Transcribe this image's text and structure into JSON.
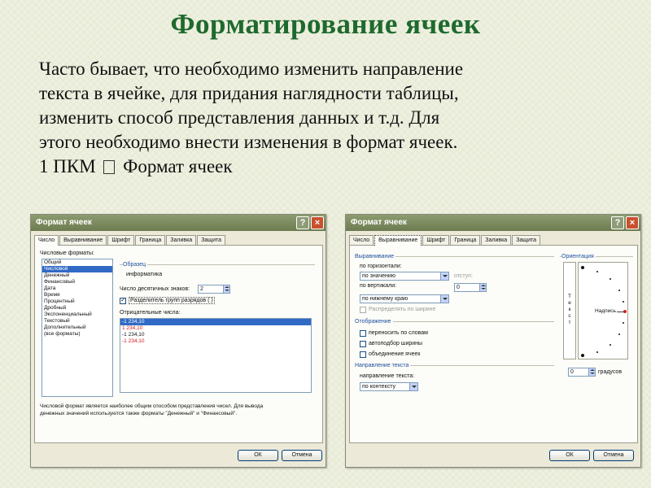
{
  "slide": {
    "title": "Форматирование ячеек",
    "paragraph_lines": [
      "Часто бывает, что необходимо изменить направление",
      "текста в ячейке, для придания наглядности таблицы,",
      "изменить способ представления данных и т.д. Для",
      "этого необходимо внести изменения в формат ячеек."
    ],
    "step_prefix": "1 ПКМ",
    "step_suffix": "Формат ячеек"
  },
  "colors": {
    "title_green": "#1e6a2e",
    "titlebar": "#7a8a5e",
    "close_red": "#c9502e",
    "selection_blue": "#316ac5",
    "negative_red": "#d41818"
  },
  "dialog_left": {
    "title": "Формат ячеек",
    "help_icon": "?",
    "close_icon": "×",
    "tabs": [
      "Число",
      "Выравнивание",
      "Шрифт",
      "Граница",
      "Заливка",
      "Защита"
    ],
    "active_tab": "Число",
    "formats_label": "Числовые форматы:",
    "formats": [
      "Общий",
      "Числовой",
      "Денежный",
      "Финансовый",
      "Дата",
      "Время",
      "Процентный",
      "Дробный",
      "Экспоненциальный",
      "Текстовый",
      "Дополнительный",
      "(все форматы)"
    ],
    "selected_format": "Числовой",
    "sample_label": "Образец",
    "sample_value": "информатика",
    "decimals_label": "Число десятичных знаков:",
    "decimals_value": "2",
    "separator_label": "Разделитель групп разрядов ( )",
    "separator_checked": true,
    "negative_label": "Отрицательные числа:",
    "negatives": [
      {
        "text": "-1 234,10",
        "red": false,
        "selected": true
      },
      {
        "text": "1 234,10",
        "red": true,
        "selected": false
      },
      {
        "text": "-1 234,10",
        "red": false,
        "selected": false
      },
      {
        "text": "-1 234,10",
        "red": true,
        "selected": false
      }
    ],
    "description_lines": [
      "Числовой формат является наиболее общим способом представления чисел. Для вывода",
      "денежных значений используются также форматы \"Денежный\" и \"Финансовый\"."
    ],
    "ok_label": "ОК",
    "cancel_label": "Отмена"
  },
  "dialog_right": {
    "title": "Формат ячеек",
    "help_icon": "?",
    "close_icon": "×",
    "tabs": [
      "Число",
      "Выравнивание",
      "Шрифт",
      "Граница",
      "Заливка",
      "Защита"
    ],
    "active_tab": "Выравнивание",
    "align_group": "Выравнивание",
    "horizontal_label": "по горизонтали:",
    "horizontal_value": "по значению",
    "indent_label": "отступ:",
    "indent_value": "0",
    "vertical_label": "по вертикали:",
    "vertical_value": "по нижнему краю",
    "distribute_label": "Распределять по ширине",
    "display_group": "Отображение",
    "wrap_label": "переносить по словам",
    "autofit_label": "автоподбор ширины",
    "merge_label": "объединение ячеек",
    "direction_group": "Направление текста",
    "direction_label": "направление текста:",
    "direction_value": "по контексту",
    "orientation_group": "Ориентация",
    "vertical_text": [
      "Т",
      "е",
      "к",
      "с",
      "т"
    ],
    "label_text": "Надпись",
    "degrees_value": "0",
    "degrees_label": "градусов",
    "ok_label": "ОК",
    "cancel_label": "Отмена"
  }
}
